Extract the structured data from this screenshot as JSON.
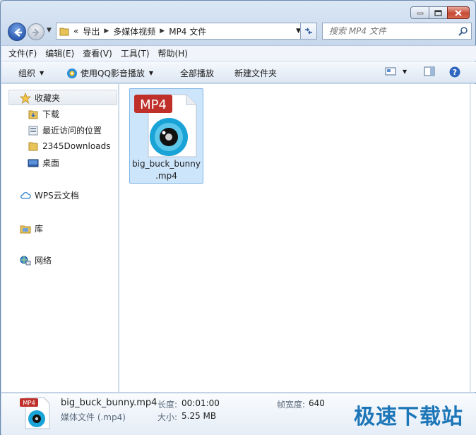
{
  "address": {
    "chevron": "«",
    "crumbs": [
      "导出",
      "多媒体视频",
      "MP4 文件"
    ]
  },
  "search": {
    "placeholder": "搜索 MP4 文件"
  },
  "menu": [
    "文件(F)",
    "编辑(E)",
    "查看(V)",
    "工具(T)",
    "帮助(H)"
  ],
  "command": {
    "organize": "组织",
    "play_qq": "使用QQ影音播放",
    "play_all": "全部播放",
    "new_folder": "新建文件夹"
  },
  "nav": {
    "favorites": "收藏夹",
    "downloads": "下载",
    "recent": "最近访问的位置",
    "downloads2345": "2345Downloads",
    "desktop": "桌面",
    "wps": "WPS云文档",
    "library": "库",
    "network": "网络"
  },
  "file": {
    "badge": "MP4",
    "name_line1": "big_buck_bunny",
    "name_line2": ".mp4"
  },
  "details": {
    "badge": "MP4",
    "filename": "big_buck_bunny.mp4",
    "type": "媒体文件 (.mp4)",
    "duration_label": "长度:",
    "duration": "00:01:00",
    "size_label": "大小:",
    "size": "5.25 MB",
    "frame_width_label": "帧宽度:",
    "frame_width": "640"
  },
  "watermark": "极速下载站",
  "colors": {
    "accent": "#1c76b8",
    "mp4_badge": "#c0302b",
    "selection": "#cde5fb"
  }
}
